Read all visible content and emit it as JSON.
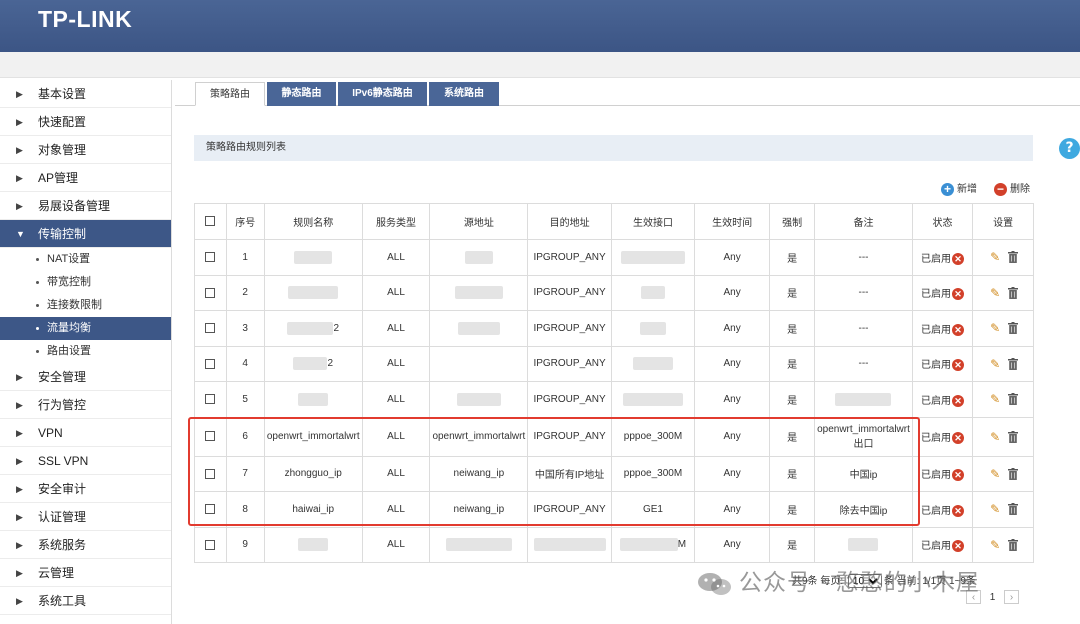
{
  "header": {
    "logo": "TP-LINK"
  },
  "sidebar": {
    "items": [
      {
        "label": "基本设置",
        "top": 0
      },
      {
        "label": "快速配置"
      },
      {
        "label": "对象管理"
      },
      {
        "label": "AP管理"
      },
      {
        "label": "易展设备管理"
      },
      {
        "label": "传输控制",
        "expanded": true
      },
      {
        "label": "安全管理"
      },
      {
        "label": "行为管控"
      },
      {
        "label": "VPN"
      },
      {
        "label": "SSL VPN"
      },
      {
        "label": "安全审计"
      },
      {
        "label": "认证管理"
      },
      {
        "label": "系统服务"
      },
      {
        "label": "云管理"
      },
      {
        "label": "系统工具"
      }
    ],
    "subitems": [
      {
        "label": "NAT设置"
      },
      {
        "label": "带宽控制"
      },
      {
        "label": "连接数限制"
      },
      {
        "label": "流量均衡",
        "active": true
      },
      {
        "label": "路由设置"
      }
    ]
  },
  "tabs": [
    {
      "label": "策略路由",
      "active": true
    },
    {
      "label": "静态路由"
    },
    {
      "label": "IPv6静态路由"
    },
    {
      "label": "系统路由"
    }
  ],
  "section_title": "策略路由规则列表",
  "actions": {
    "add": "新增",
    "delete": "删除"
  },
  "table": {
    "headers": [
      "序号",
      "规则名称",
      "服务类型",
      "源地址",
      "目的地址",
      "生效接口",
      "生效时间",
      "强制",
      "备注",
      "状态",
      "设置"
    ],
    "rows": [
      {
        "no": "1",
        "name": "",
        "service": "ALL",
        "src": "",
        "dst": "IPGROUP_ANY",
        "iface": "",
        "time": "Any",
        "force": "是",
        "note": "---",
        "status": "已启用"
      },
      {
        "no": "2",
        "name": "",
        "service": "ALL",
        "src": "",
        "dst": "IPGROUP_ANY",
        "iface": "",
        "time": "Any",
        "force": "是",
        "note": "---",
        "status": "已启用"
      },
      {
        "no": "3",
        "name": "2",
        "service": "ALL",
        "src": "",
        "dst": "IPGROUP_ANY",
        "iface": "",
        "time": "Any",
        "force": "是",
        "note": "---",
        "status": "已启用"
      },
      {
        "no": "4",
        "name": "2",
        "service": "ALL",
        "src": "",
        "dst": "IPGROUP_ANY",
        "iface": "",
        "time": "Any",
        "force": "是",
        "note": "---",
        "status": "已启用"
      },
      {
        "no": "5",
        "name": "",
        "service": "ALL",
        "src": "",
        "dst": "IPGROUP_ANY",
        "iface": "",
        "time": "Any",
        "force": "是",
        "note": "",
        "status": "已启用"
      },
      {
        "no": "6",
        "name": "openwrt_immortalwrt",
        "service": "ALL",
        "src": "openwrt_immortalwrt",
        "dst": "IPGROUP_ANY",
        "iface": "pppoe_300M",
        "time": "Any",
        "force": "是",
        "note": "openwrt_immortalwrt出口",
        "status": "已启用"
      },
      {
        "no": "7",
        "name": "zhongguo_ip",
        "service": "ALL",
        "src": "neiwang_ip",
        "dst": "中国所有IP地址",
        "iface": "pppoe_300M",
        "time": "Any",
        "force": "是",
        "note": "中国ip",
        "status": "已启用"
      },
      {
        "no": "8",
        "name": "haiwai_ip",
        "service": "ALL",
        "src": "neiwang_ip",
        "dst": "IPGROUP_ANY",
        "iface": "GE1",
        "time": "Any",
        "force": "是",
        "note": "除去中国ip",
        "status": "已启用"
      },
      {
        "no": "9",
        "name": "",
        "service": "ALL",
        "src": "",
        "dst": "",
        "iface": "M",
        "time": "Any",
        "force": "是",
        "note": "",
        "status": "已启用"
      }
    ]
  },
  "pagination": {
    "total": "共9条",
    "per_page_label": "每页:",
    "per_page": "10",
    "per_page_unit": "条",
    "current_label": "当前:",
    "pages": "1/1页",
    "range": "1~9条",
    "page_num": "1"
  },
  "watermark": "公众号 · 憨憨的小木屋",
  "colors": {
    "header": "#3c5585",
    "accent": "#3d5787",
    "status_x": "#d2402a",
    "highlight_box": "#e23b2f",
    "help": "#3fa9e0"
  }
}
